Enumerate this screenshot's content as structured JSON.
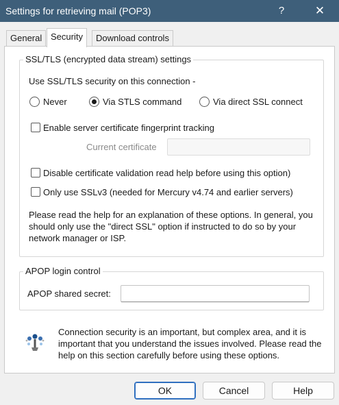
{
  "window": {
    "title": "Settings for retrieving mail (POP3)",
    "help_glyph": "?",
    "close_glyph": "✕"
  },
  "tabs": [
    {
      "label": "General"
    },
    {
      "label": "Security",
      "active": true
    },
    {
      "label": "Download controls"
    }
  ],
  "ssl_group": {
    "label": "SSL/TLS (encrypted data stream) settings",
    "prompt": "Use SSL/TLS security on this connection -",
    "options": [
      {
        "label": "Never",
        "checked": false
      },
      {
        "label": "Via STLS command",
        "checked": true
      },
      {
        "label": "Via direct SSL connect",
        "checked": false
      }
    ],
    "fingerprint_label": "Enable server certificate fingerprint tracking",
    "current_cert_label": "Current certificate",
    "current_cert_value": "",
    "disable_validation_label": "Disable certificate validation read help before using this option)",
    "sslv3_label": "Only use SSLv3 (needed for Mercury v4.74 and earlier servers)",
    "help_text": "Please read the help for an explanation of these options. In general, you should only use the \"direct SSL\" option if instructed to do so by your network manager or ISP."
  },
  "apop_group": {
    "label": "APOP login control",
    "secret_label": "APOP shared secret:",
    "secret_value": ""
  },
  "info": {
    "icon": "security-info-icon",
    "text": "Connection security is an important, but complex area, and it is important that you understand the issues involved. Please read the help on this section carefully before using these options."
  },
  "buttons": {
    "ok": "OK",
    "cancel": "Cancel",
    "help": "Help"
  },
  "colors": {
    "titlebar": "#3e5f7a",
    "default_button_border": "#2f6fbf"
  }
}
